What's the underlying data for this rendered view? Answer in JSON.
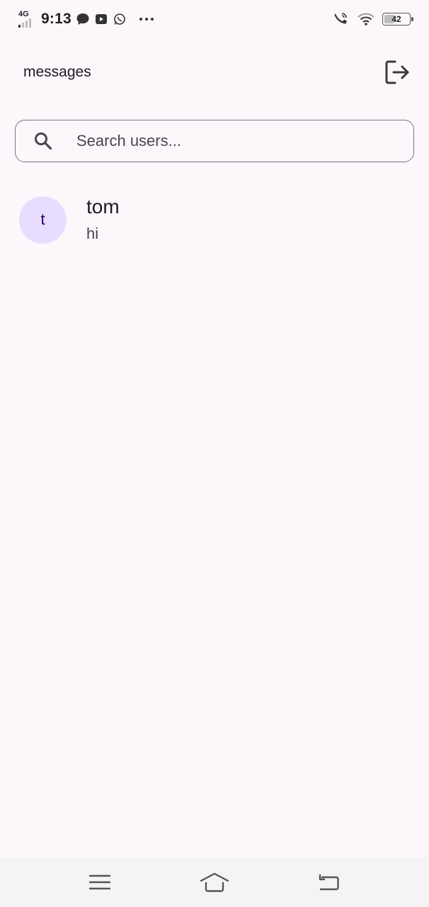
{
  "status_bar": {
    "network_type": "4G",
    "time": "9:13",
    "battery_level": "42",
    "battery_fraction": 0.42,
    "notification_icons": [
      "message-icon",
      "youtube-icon",
      "whatsapp-icon",
      "more-dots-icon"
    ],
    "system_icons": [
      "wifi-calling-icon",
      "wifi-icon",
      "battery-icon"
    ]
  },
  "header": {
    "title": "messages",
    "logout_icon": "logout-icon"
  },
  "search": {
    "placeholder": "Search users...",
    "value": "",
    "icon": "search-icon"
  },
  "chats": [
    {
      "avatar_letter": "t",
      "name": "tom",
      "last_message": "hi"
    }
  ],
  "nav_bar": {
    "buttons": [
      "menu-icon",
      "home-icon",
      "back-icon"
    ]
  },
  "colors": {
    "background": "#fdf7fc",
    "avatar_bg": "#e9ddff",
    "outline": "#79747e",
    "nav_bg": "#f4f4f4"
  }
}
